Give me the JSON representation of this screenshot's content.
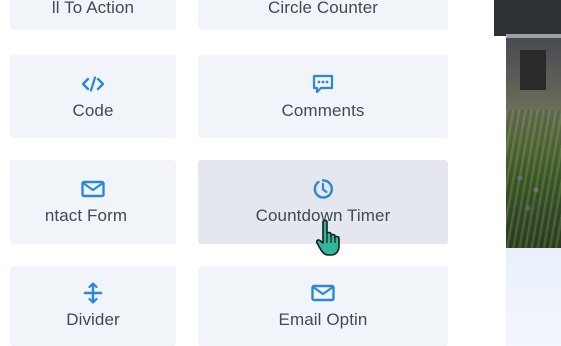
{
  "modules": [
    {
      "id": "call-to-action",
      "label": "ll To Action",
      "icon": null
    },
    {
      "id": "circle-counter",
      "label": "Circle Counter",
      "icon": null
    },
    {
      "id": "code",
      "label": "Code",
      "icon": "code-icon"
    },
    {
      "id": "comments",
      "label": "Comments",
      "icon": "comments-icon"
    },
    {
      "id": "contact-form",
      "label": "ntact Form",
      "icon": "envelope-icon"
    },
    {
      "id": "countdown-timer",
      "label": "Countdown Timer",
      "icon": "clock-icon"
    },
    {
      "id": "divider",
      "label": "Divider",
      "icon": "divider-icon"
    },
    {
      "id": "email-optin",
      "label": "Email Optin",
      "icon": "envelope-icon"
    }
  ],
  "colors": {
    "tile_bg": "#f1f5f9",
    "tile_hover_bg": "#e4e8ee",
    "icon_blue": "#2b87da",
    "label": "#3f4a57",
    "cursor_green": "#2fb89a"
  },
  "hovered": "countdown-timer"
}
